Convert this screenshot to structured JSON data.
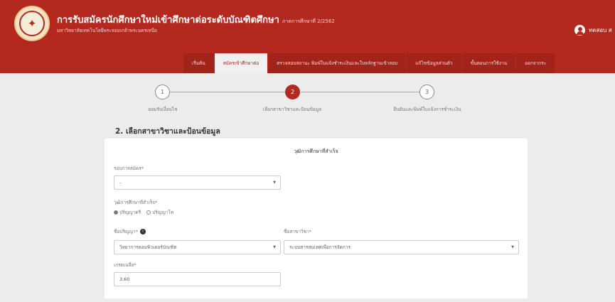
{
  "header": {
    "title": "การรับสมัครนักศึกษาใหม่เข้าศึกษาต่อระดับบัณฑิตศึกษา",
    "term": "ภาคการศึกษาที่ 2/2562",
    "subtitle": "มหาวิทยาลัยเทคโนโลยีพระจอมเกล้าพระนครเหนือ",
    "user": "ทดสอบ ส",
    "logo_icon": "university-seal-icon",
    "user_icon": "user-circle-icon"
  },
  "tabs": [
    {
      "label": "เริ่มต้น",
      "active": false
    },
    {
      "label": "สมัครเข้าศึกษาต่อ",
      "active": true
    },
    {
      "label": "ตรวจสอบสถานะ พิมพ์ใบแจ้งชำระเงินและใบหลักฐานเข้าสอบ",
      "active": false
    },
    {
      "label": "แก้ไขข้อมูลส่วนตัว",
      "active": false
    },
    {
      "label": "ขั้นตอนการใช้งาน",
      "active": false
    },
    {
      "label": "ออกจากระ",
      "active": false
    }
  ],
  "steps": [
    {
      "number": "1",
      "label": "ยอมรับเงื่อนไข",
      "active": false
    },
    {
      "number": "2",
      "label": "เลือกสาขาวิชาและป้อนข้อมูล",
      "active": true
    },
    {
      "number": "3",
      "label": "ยืนยันและพิมพ์ใบแจ้งการชำระเงิน",
      "active": false
    }
  ],
  "section_title": "2. เลือกสาขาวิชาและป้อนข้อมูล",
  "form": {
    "card_title": "วุฒิการศึกษาที่สำเร็จ",
    "round_label": "รอบการสมัคร*",
    "round_value": "-",
    "qualification_label": "วุฒิการศึกษาที่สำเร็จ*",
    "radio_options": [
      {
        "label": "ปริญญาตรี",
        "checked": true
      },
      {
        "label": "ปริญญาโท",
        "checked": false
      }
    ],
    "degree_label": "ชื่อปริญญา*",
    "degree_value": "วิทยาการคอมพิวเตอร์บัณฑิต",
    "major_label": "ชื่อสาขาวิชา*",
    "major_value": "ระบบสารสนเทศเพื่อการจัดการ",
    "gpa_label": "เกรดเฉลี่ย*",
    "gpa_value": "3.60",
    "info_icon": "info-icon",
    "caret_icon": "chevron-down-icon"
  }
}
